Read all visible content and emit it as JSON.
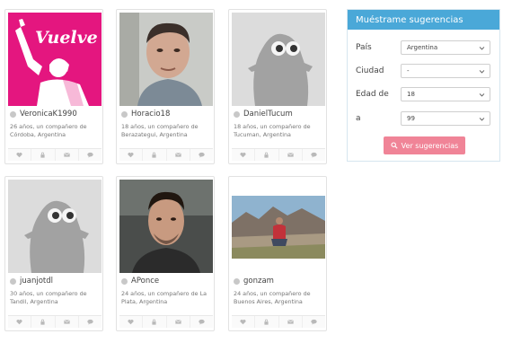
{
  "profiles": [
    {
      "username": "VeronicaK1990",
      "desc": "26 años, un compañero de Córdoba, Argentina",
      "photo_text": "Vuelve"
    },
    {
      "username": "Horacio18",
      "desc": "18 años, un compañero de Berazategui, Argentina"
    },
    {
      "username": "DanielTucum",
      "desc": "18 años, un compañero de Tucuman, Argentina"
    },
    {
      "username": "juanjotdl",
      "desc": "30 años, un compañero de Tandil, Argentina"
    },
    {
      "username": "APonce",
      "desc": "24 años, un compañero de La Plata, Argentina"
    },
    {
      "username": "gonzam",
      "desc": "24 años, un compañero de Buenos Aires, Argentina"
    }
  ],
  "actions": [
    "heart-icon",
    "lock-icon",
    "envelope-icon",
    "chat-icon"
  ],
  "suggestions": {
    "title": "Muéstrame sugerencias",
    "fields": [
      {
        "label": "País",
        "value": "Argentina"
      },
      {
        "label": "Ciudad",
        "value": "-"
      },
      {
        "label": "Edad de",
        "value": "18"
      },
      {
        "label": "a",
        "value": "99"
      }
    ],
    "button": "Ver sugerencias"
  },
  "colors": {
    "header": "#4aa8d8",
    "button": "#f08497",
    "magenta": "#e4167f"
  }
}
